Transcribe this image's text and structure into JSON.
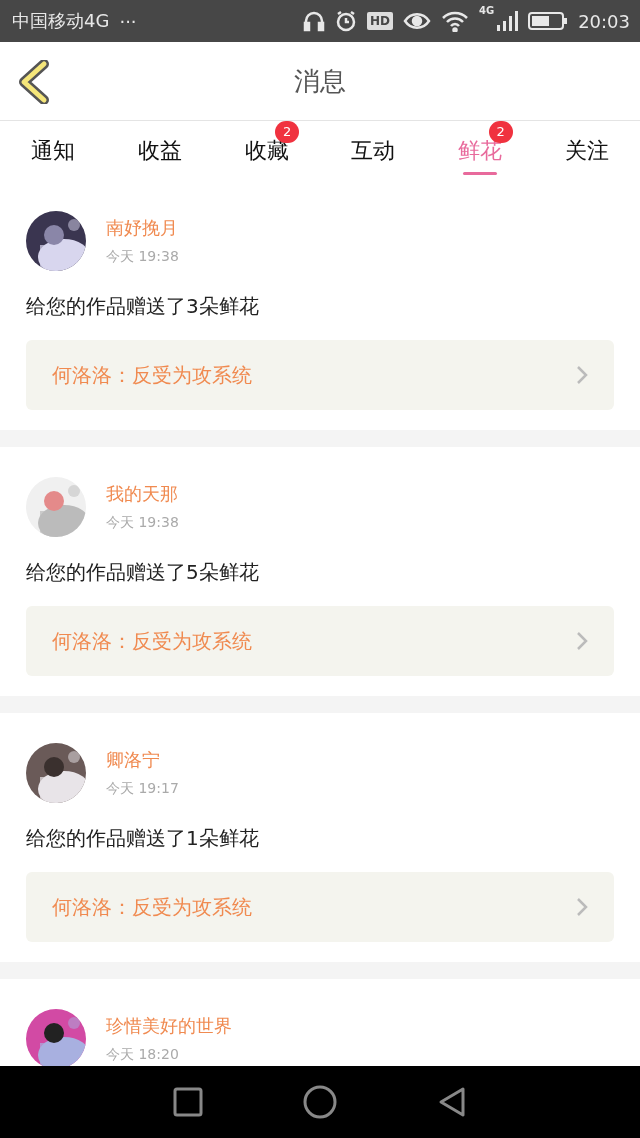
{
  "status_bar": {
    "carrier": "中国移动4G",
    "more": "···",
    "hd": "HD",
    "network": "4G",
    "time": "20:03"
  },
  "header": {
    "title": "消息"
  },
  "tabs": [
    {
      "label": "通知",
      "selected": false
    },
    {
      "label": "收益",
      "selected": false
    },
    {
      "label": "收藏",
      "selected": false,
      "badge": "2"
    },
    {
      "label": "互动",
      "selected": false
    },
    {
      "label": "鲜花",
      "selected": true,
      "badge": "2"
    },
    {
      "label": "关注",
      "selected": false
    }
  ],
  "messages": [
    {
      "name": "南妤挽月",
      "time": "今天 19:38",
      "text": "给您的作品赠送了3朵鲜花",
      "work": "何洛洛：反受为攻系统"
    },
    {
      "name": "我的天那",
      "time": "今天 19:38",
      "text": "给您的作品赠送了5朵鲜花",
      "work": "何洛洛：反受为攻系统"
    },
    {
      "name": "卿洛宁",
      "time": "今天 19:17",
      "text": "给您的作品赠送了1朵鲜花",
      "work": "何洛洛：反受为攻系统"
    },
    {
      "name": "珍惜美好的世界",
      "time": "今天 18:20"
    }
  ]
}
